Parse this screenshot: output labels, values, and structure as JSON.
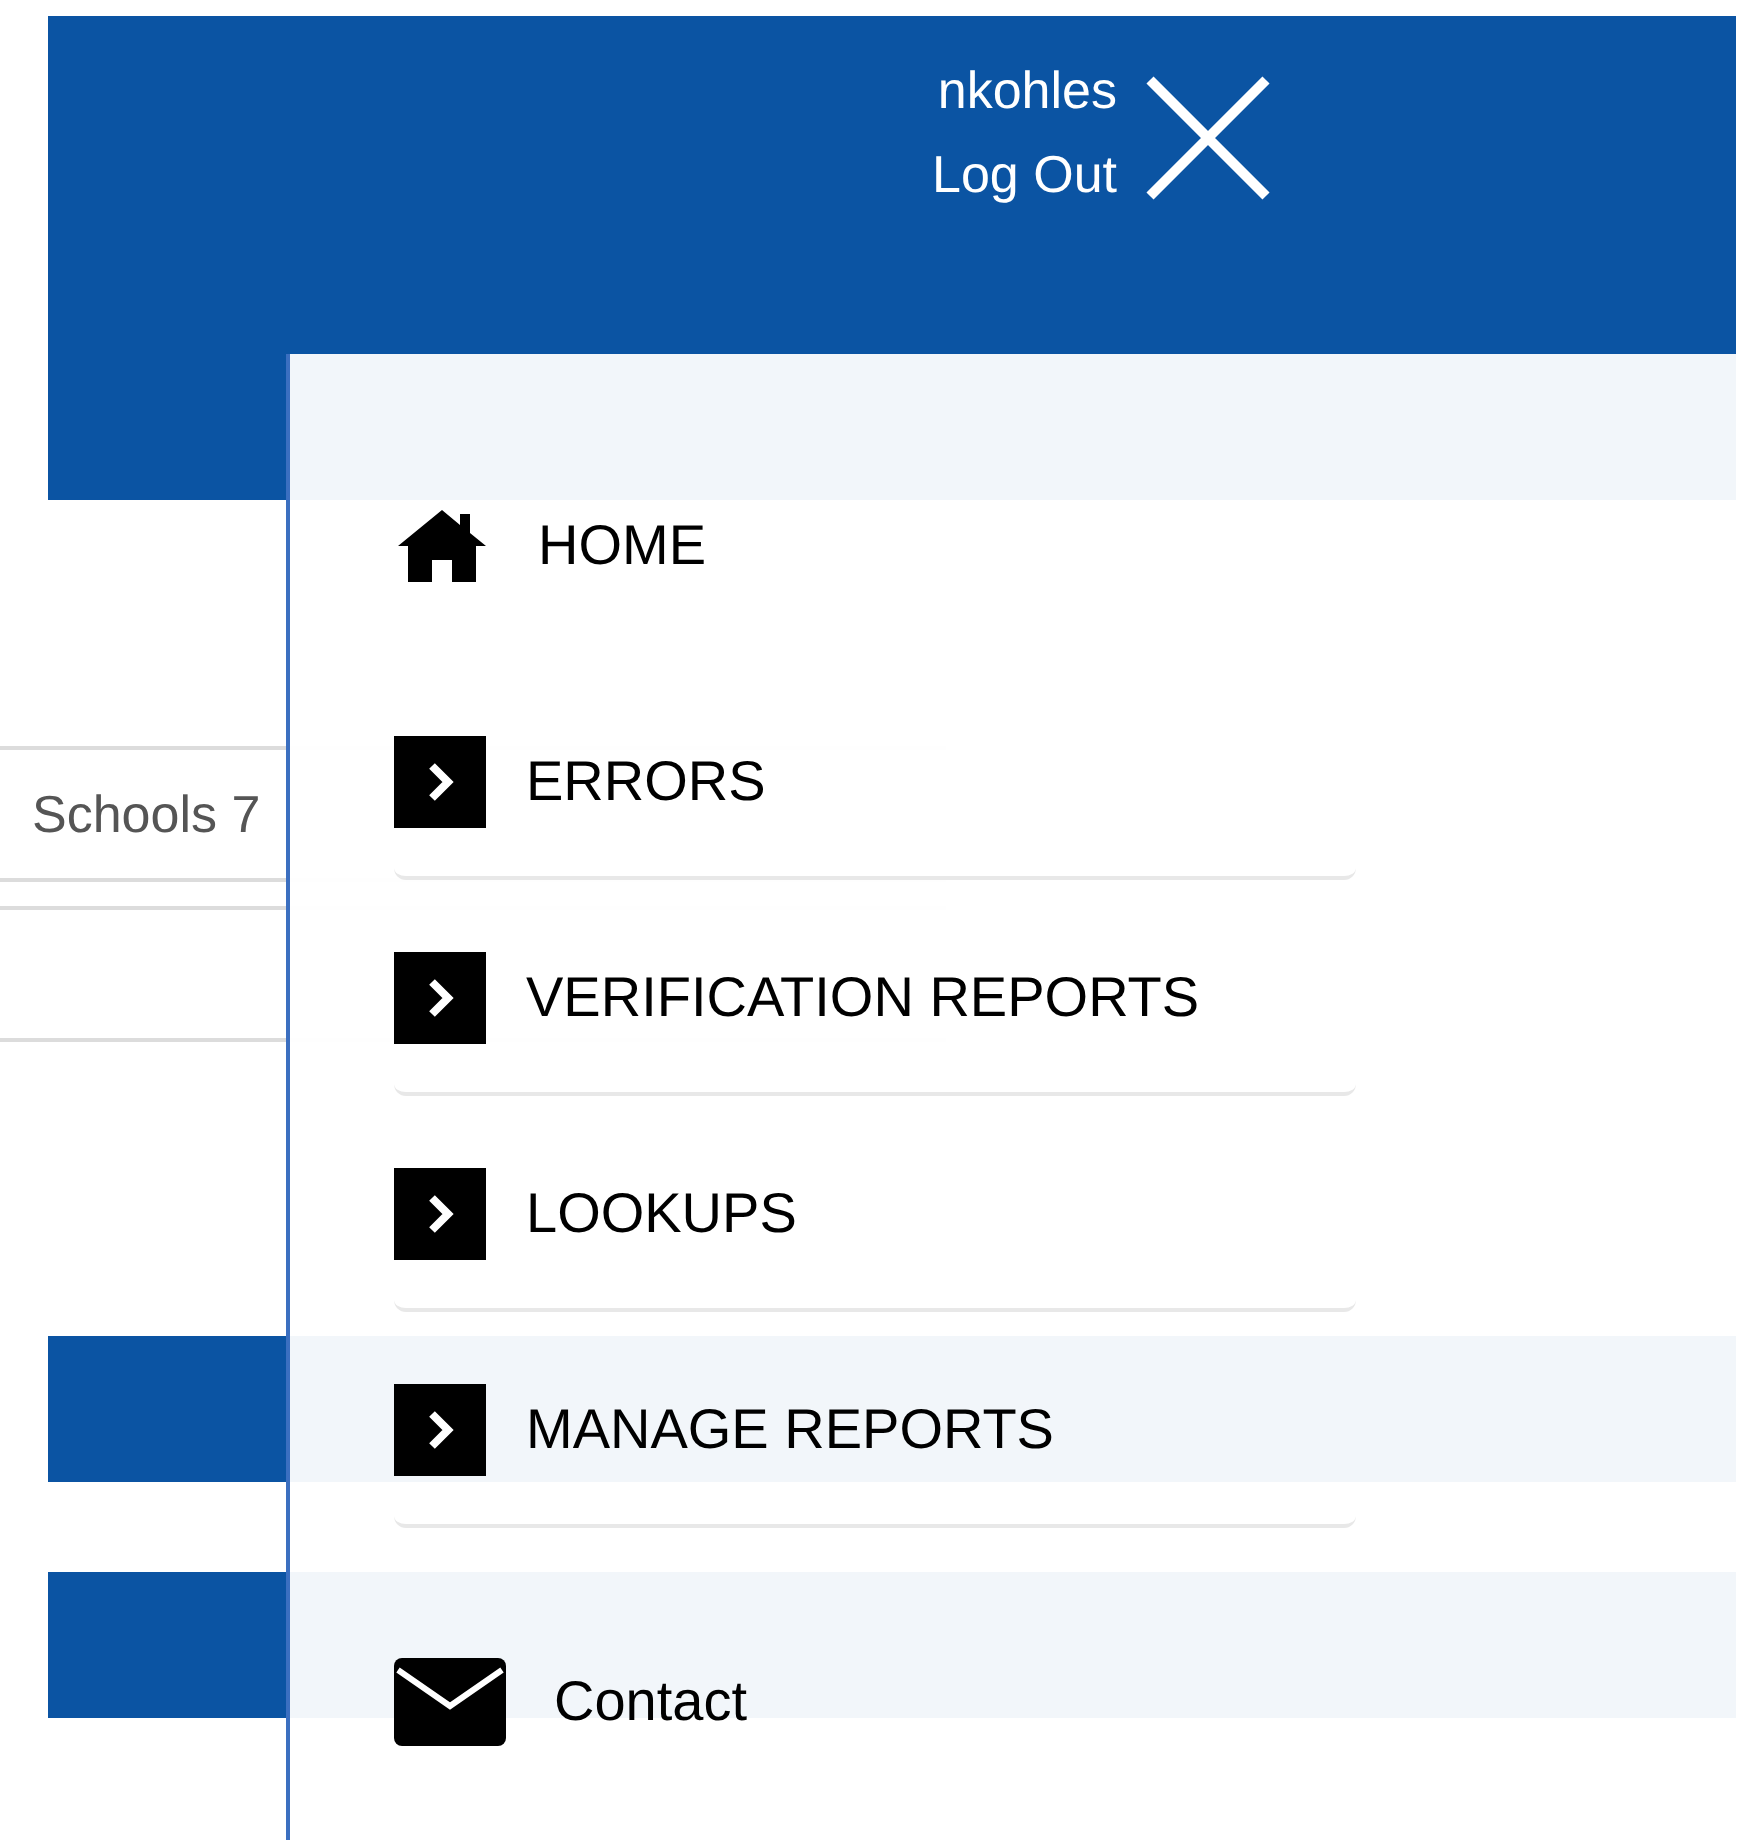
{
  "header": {
    "username": "nkohles",
    "logout": "Log Out"
  },
  "background": {
    "school_select": "Schools 7"
  },
  "menu": [
    {
      "kind": "home",
      "label": "HOME"
    },
    {
      "kind": "section",
      "label": "ERRORS"
    },
    {
      "kind": "section",
      "label": "VERIFICATION REPORTS"
    },
    {
      "kind": "section",
      "label": "LOOKUPS"
    },
    {
      "kind": "section",
      "label": "MANAGE REPORTS"
    },
    {
      "kind": "contact",
      "label": "Contact"
    }
  ]
}
